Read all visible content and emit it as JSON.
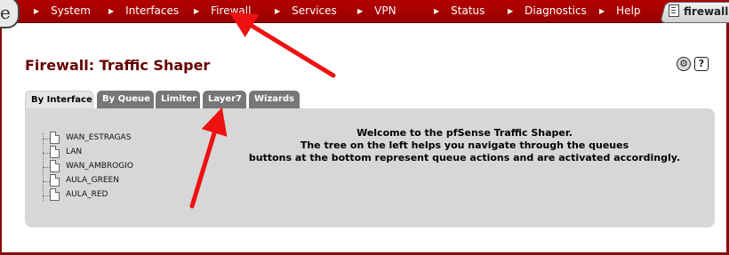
{
  "nav": {
    "items": [
      {
        "label": "System"
      },
      {
        "label": "Interfaces"
      },
      {
        "label": "Firewall"
      },
      {
        "label": "Services"
      },
      {
        "label": "VPN"
      },
      {
        "label": "Status"
      },
      {
        "label": "Diagnostics"
      },
      {
        "label": "Help"
      }
    ],
    "hostname": "firewall."
  },
  "page": {
    "title": "Firewall: Traffic Shaper"
  },
  "tabs": [
    {
      "label": "By Interface",
      "active": true
    },
    {
      "label": "By Queue",
      "active": false
    },
    {
      "label": "Limiter",
      "active": false
    },
    {
      "label": "Layer7",
      "active": false
    },
    {
      "label": "Wizards",
      "active": false
    }
  ],
  "tree": {
    "items": [
      {
        "label": "WAN_ESTRAGAS"
      },
      {
        "label": "LAN"
      },
      {
        "label": "WAN_AMBROGIO"
      },
      {
        "label": "AULA_GREEN"
      },
      {
        "label": "AULA_RED"
      }
    ]
  },
  "welcome": {
    "line1": "Welcome to the pfSense Traffic Shaper.",
    "line2": "The tree on the left helps you navigate through the queues",
    "line3": "buttons at the bottom represent queue actions and are activated accordingly."
  },
  "colors": {
    "nav_bg": "#a80000",
    "title": "#660000",
    "annotation_arrow": "#ee1111"
  },
  "icons": {
    "gear": "gear-icon",
    "help": "help-icon"
  }
}
